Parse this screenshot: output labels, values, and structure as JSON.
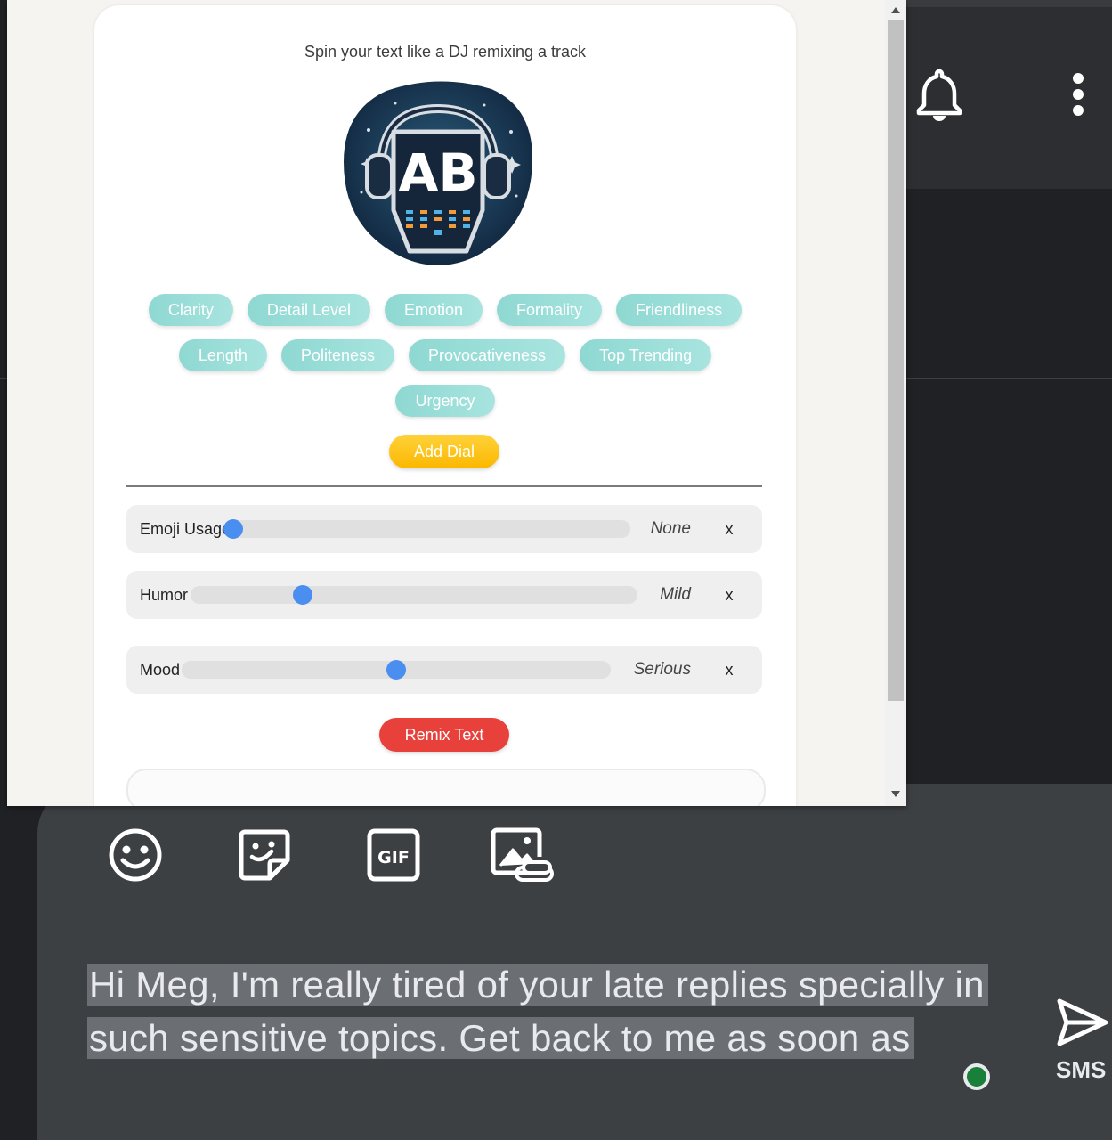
{
  "popup": {
    "tagline": "Spin your text like a DJ remixing a track",
    "logo_text": "AB",
    "chips": [
      "Clarity",
      "Detail Level",
      "Emotion",
      "Formality",
      "Friendliness",
      "Length",
      "Politeness",
      "Provocativeness",
      "Top Trending",
      "Urgency"
    ],
    "add_dial_label": "Add Dial",
    "dials": [
      {
        "label": "Emoji Usage",
        "value": "None",
        "level": 0.0
      },
      {
        "label": "Humor",
        "value": "Mild",
        "level": 0.25
      },
      {
        "label": "Mood",
        "value": "Serious",
        "level": 0.5
      }
    ],
    "remove_label": "x",
    "remix_label": "Remix Text",
    "output_text": ""
  },
  "compose": {
    "message": "Hi Meg, I'm really tired of your late replies specially in such sensitive topics. Get back to me as soon as",
    "send_label": "SMS"
  },
  "icons": {
    "toolbar": [
      "emoji-icon",
      "sticker-icon",
      "gif-icon",
      "gallery-icon"
    ],
    "topbar": [
      "notification-bell-icon",
      "more-options-icon"
    ]
  },
  "colors": {
    "chip": "#9ddfd9",
    "add_dial": "#fbc21a",
    "remix": "#e8403a",
    "slider_thumb": "#4a8ef0",
    "compose_bg": "#3c4043"
  }
}
